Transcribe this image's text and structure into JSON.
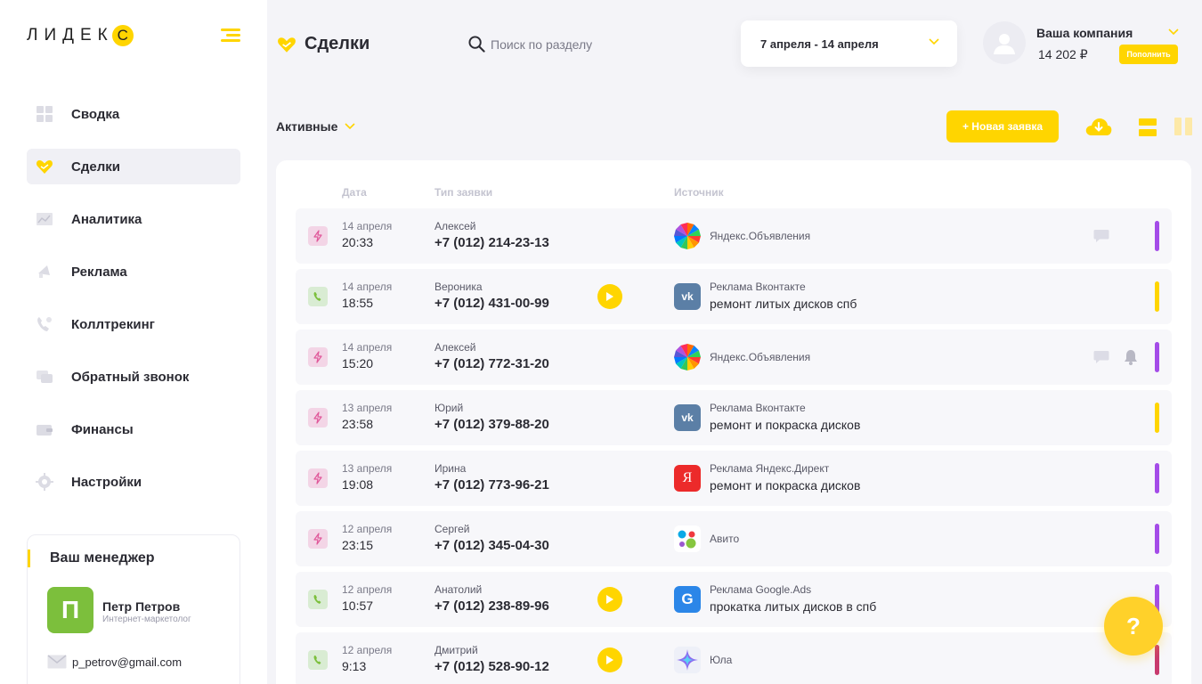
{
  "brand": {
    "logo_text": "ЛИДЕК",
    "logo_letter": "С",
    "accent": "#ffd500"
  },
  "sidebar": {
    "items": [
      {
        "label": "Сводка",
        "icon": "grid-icon"
      },
      {
        "label": "Сделки",
        "icon": "heart-handshake-icon",
        "active": true
      },
      {
        "label": "Аналитика",
        "icon": "chart-icon"
      },
      {
        "label": "Реклама",
        "icon": "megaphone-icon"
      },
      {
        "label": "Коллтрекинг",
        "icon": "phone-icon"
      },
      {
        "label": "Обратный звонок",
        "icon": "chat-icon"
      },
      {
        "label": "Финансы",
        "icon": "wallet-icon"
      },
      {
        "label": "Настройки",
        "icon": "gear-icon"
      }
    ],
    "manager": {
      "title": "Ваш менеджер",
      "initial": "П",
      "name": "Петр Петров",
      "role": "Интернет-маркетолог",
      "email": "p_petrov@gmail.com"
    }
  },
  "header": {
    "title": "Сделки",
    "search_placeholder": "Поиск по разделу",
    "date_range": "7 апреля - 14 апреля",
    "company": "Ваша компания",
    "balance": "14 202 ₽",
    "topup_label": "Пополнить"
  },
  "toolbar": {
    "filter_label": "Активные",
    "new_button": "+ Новая заявка"
  },
  "table": {
    "columns": [
      "Дата",
      "Тип заявки",
      "Источник"
    ],
    "rows": [
      {
        "type": "deal",
        "date": "14 апреля",
        "time": "20:33",
        "name": "Алексей",
        "phone": "+7 (012) 214-23-13",
        "play": false,
        "source": "yandex-ads",
        "source_name": "Яндекс.Объявления",
        "source_sub": "",
        "comment": true,
        "bell": false,
        "marker": "#a44ce8"
      },
      {
        "type": "call",
        "date": "14 апреля",
        "time": "18:55",
        "name": "Вероника",
        "phone": "+7 (012) 431-00-99",
        "play": true,
        "source": "vk",
        "source_name": "Реклама Вконтакте",
        "source_sub": "ремонт литых дисков спб",
        "comment": false,
        "bell": false,
        "marker": "#ffd500"
      },
      {
        "type": "deal",
        "date": "14 апреля",
        "time": "15:20",
        "name": "Алексей",
        "phone": "+7 (012) 772-31-20",
        "play": false,
        "source": "yandex-ads",
        "source_name": "Яндекс.Объявления",
        "source_sub": "",
        "comment": true,
        "bell": true,
        "marker": "#a44ce8"
      },
      {
        "type": "deal",
        "date": "13 апреля",
        "time": "23:58",
        "name": "Юрий",
        "phone": "+7 (012) 379-88-20",
        "play": false,
        "source": "vk",
        "source_name": "Реклама Вконтакте",
        "source_sub": "ремонт и покраска дисков",
        "comment": false,
        "bell": false,
        "marker": "#ffd500"
      },
      {
        "type": "deal",
        "date": "13 апреля",
        "time": "19:08",
        "name": "Ирина",
        "phone": "+7 (012) 773-96-21",
        "play": false,
        "source": "yandex-direct",
        "source_name": "Реклама Яндекс.Директ",
        "source_sub": "ремонт и покраска дисков",
        "comment": false,
        "bell": false,
        "marker": "#a44ce8"
      },
      {
        "type": "deal",
        "date": "12 апреля",
        "time": "23:15",
        "name": "Сергей",
        "phone": "+7 (012) 345-04-30",
        "play": false,
        "source": "avito",
        "source_name": "Авито",
        "source_sub": "",
        "comment": false,
        "bell": false,
        "marker": "#a44ce8"
      },
      {
        "type": "call",
        "date": "12 апреля",
        "time": "10:57",
        "name": "Анатолий",
        "phone": "+7 (012) 238-89-96",
        "play": true,
        "source": "google-ads",
        "source_name": "Реклама Google.Ads",
        "source_sub": "прокатка литых дисков в спб",
        "comment": false,
        "bell": false,
        "marker": "#a44ce8"
      },
      {
        "type": "call",
        "date": "12 апреля",
        "time": "9:13",
        "name": "Дмитрий",
        "phone": "+7 (012) 528-90-12",
        "play": true,
        "source": "youla",
        "source_name": "Юла",
        "source_sub": "",
        "comment": false,
        "bell": false,
        "marker": "#c83a6e"
      }
    ]
  },
  "help": {
    "label": "?"
  }
}
